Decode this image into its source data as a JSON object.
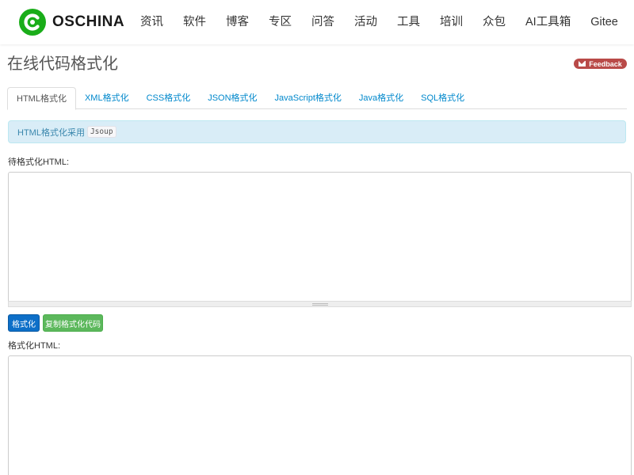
{
  "brand": {
    "name": "OSCHINA",
    "color": "#1aad19"
  },
  "nav": {
    "items": [
      "资讯",
      "软件",
      "博客",
      "专区",
      "问答",
      "活动",
      "工具",
      "培训",
      "众包",
      "AI工具箱",
      "Gitee"
    ]
  },
  "page": {
    "title": "在线代码格式化",
    "feedback_label": "Feedback"
  },
  "tabs": [
    "HTML格式化",
    "XML格式化",
    "CSS格式化",
    "JSON格式化",
    "JavaScript格式化",
    "Java格式化",
    "SQL格式化"
  ],
  "active_tab": "HTML格式化",
  "alert": {
    "text": "HTML格式化采用",
    "code": "Jsoup"
  },
  "input": {
    "label": "待格式化HTML:",
    "value": ""
  },
  "buttons": {
    "format": "格式化",
    "copy": "复制格式化代码"
  },
  "output": {
    "label": "格式化HTML:",
    "value": ""
  },
  "colors": {
    "link": "#0088cc",
    "primary": "#0d6fc8",
    "success": "#5cb85c",
    "danger": "#b94a48",
    "info_bg": "#d9edf7"
  }
}
